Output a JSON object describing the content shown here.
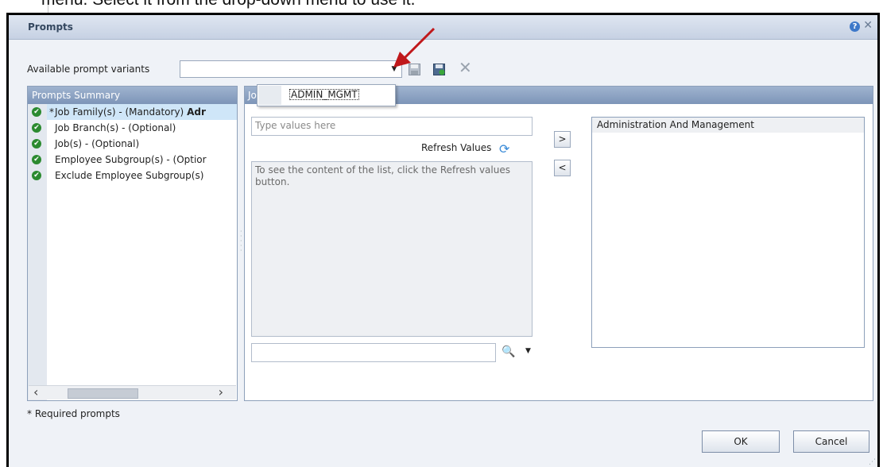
{
  "document": {
    "caption": "menu. Select it from the drop-down menu to use it."
  },
  "dialog": {
    "title": "Prompts",
    "help_icon": "help-icon",
    "close_icon": "close-icon",
    "variant_label": "Available prompt variants",
    "variant_value": "",
    "variant_options": [
      "ADMIN_MGMT"
    ],
    "summary_title": "Prompts Summary",
    "prompts": [
      {
        "star": "*",
        "label": "Job Family(s) - (Mandatory)",
        "value": "Adr",
        "selected": true
      },
      {
        "star": "",
        "label": "Job Branch(s) - (Optional)",
        "value": ""
      },
      {
        "star": "",
        "label": "Job(s) - (Optional)",
        "value": ""
      },
      {
        "star": "",
        "label": "Employee Subgroup(s) - (Optior",
        "value": ""
      },
      {
        "star": "",
        "label": "Exclude Employee Subgroup(s) ",
        "value": ""
      }
    ],
    "main_title": "Jo",
    "type_placeholder": "Type values here",
    "refresh_label": "Refresh Values",
    "list_hint": "To see the content of the list, click the Refresh values button.",
    "add_label": ">",
    "remove_label": "<",
    "selected_values": [
      "Administration And Management"
    ],
    "required_note": "* Required prompts",
    "ok_label": "OK",
    "cancel_label": "Cancel",
    "accent_color": "#7d95b8",
    "check_color": "#2b8a30",
    "annotation_arrow_color": "#c0181b"
  }
}
